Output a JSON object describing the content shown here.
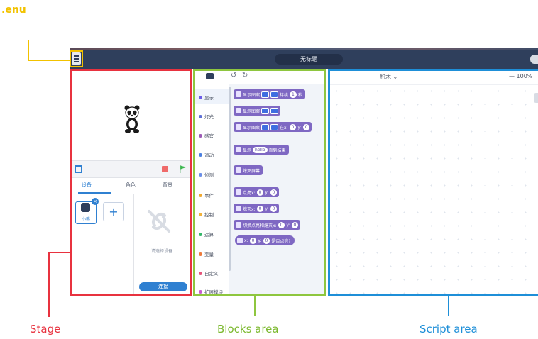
{
  "callouts": {
    "menu": ".enu",
    "stage": "Stage",
    "blocks": "Blocks area",
    "script": "Script area"
  },
  "colors": {
    "menu": "#f2c200",
    "stage": "#e8323f",
    "blocks": "#8ec63f",
    "script": "#1e8fd8",
    "topbar": "#2f3f5c",
    "block": "#7f68c3"
  },
  "topbar": {
    "project_title": "无标题",
    "menu_icon": "hamburger-menu-icon"
  },
  "stage": {
    "tabs": [
      "设备",
      "角色",
      "背景"
    ],
    "active_tab": "设备",
    "device_label": "小熊",
    "device_badge": "×",
    "add_device": "+",
    "select_hint": "请选择设备",
    "connect_button": "连接"
  },
  "blocks": {
    "categories": [
      {
        "label": "显示",
        "color": "#6c5ce7"
      },
      {
        "label": "灯光",
        "color": "#5d6fd6"
      },
      {
        "label": "感官",
        "color": "#9b59b6"
      },
      {
        "label": "运动",
        "color": "#4a7fe0"
      },
      {
        "label": "侦测",
        "color": "#6a8ee8"
      },
      {
        "label": "事件",
        "color": "#f0a830"
      },
      {
        "label": "控制",
        "color": "#f2b23a"
      },
      {
        "label": "运算",
        "color": "#35b86a"
      },
      {
        "label": "变量",
        "color": "#ee7a3a"
      },
      {
        "label": "自定义",
        "color": "#e7557a"
      },
      {
        "label": "扩展模块",
        "color": "#c95ad0"
      }
    ],
    "palette": {
      "b1_text": "显示图案",
      "b1_mid": "持续",
      "b1_num": "1",
      "b1_end": "秒",
      "b2_text": "显示图案",
      "b3_text": "显示图案",
      "b3_x": "在x:",
      "b3_xv": "0",
      "b3_y": "y:",
      "b3_yv": "0",
      "b4_text": "显示",
      "b4_pill": "hello",
      "b4_end": "直到结束",
      "b5_text": "熄灭屏幕",
      "b6_text": "点亮x:",
      "b6_xv": "0",
      "b6_y": "y:",
      "b6_yv": "0",
      "b7_text": "熄灭x:",
      "b7_xv": "0",
      "b7_y": "y:",
      "b7_yv": "0",
      "b8_text": "切换点亮和熄灭x:",
      "b8_xv": "0",
      "b8_y": "y:",
      "b8_yv": "0",
      "b9_text": "x:",
      "b9_xv": "0",
      "b9_y": "y:",
      "b9_yv": "0",
      "b9_end": "是否点亮?"
    }
  },
  "script": {
    "mode": "积木 ⌄",
    "zoom": "— 100%"
  }
}
